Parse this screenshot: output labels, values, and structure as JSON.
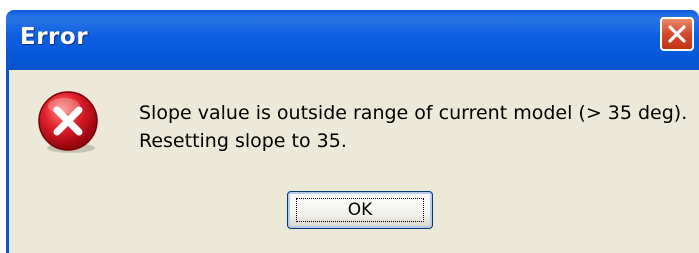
{
  "dialog": {
    "title": "Error",
    "message_line1": "Slope value is outside range of current model (> 35 deg).",
    "message_line2": "Resetting slope to 35.",
    "ok_label": "OK",
    "icons": {
      "error": "error-icon",
      "close": "close-icon"
    }
  },
  "colors": {
    "titlebar": "#0a5ad8",
    "client_bg": "#ece9d8",
    "close_button": "#d5492a",
    "error_red": "#c8141e"
  }
}
